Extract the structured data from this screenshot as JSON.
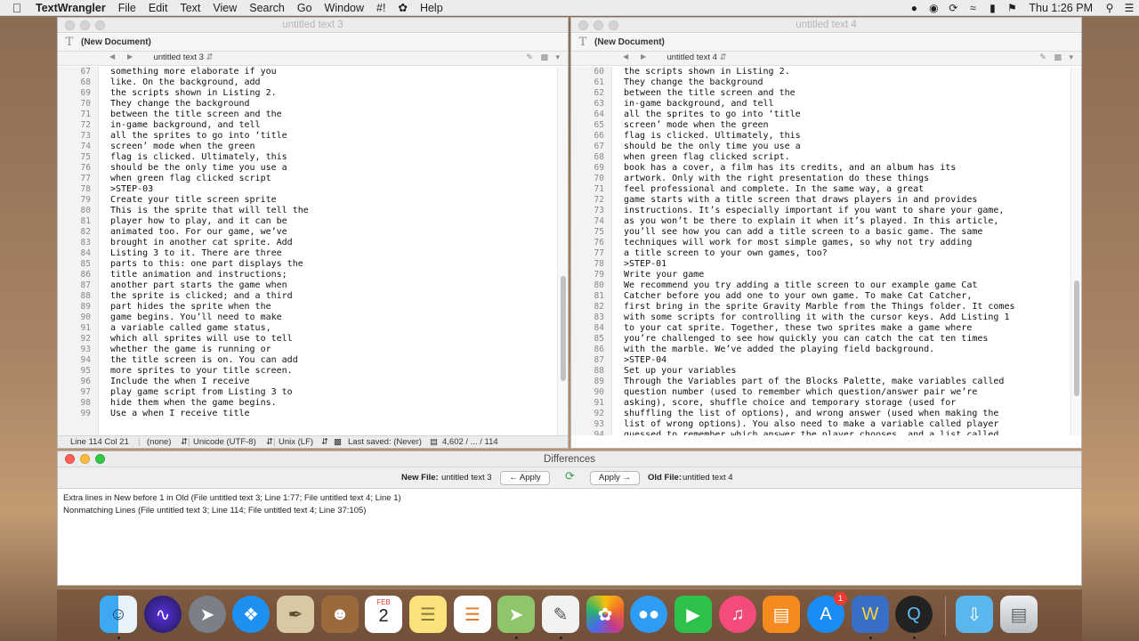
{
  "menubar": {
    "app_name": "TextWrangler",
    "items": [
      "File",
      "Edit",
      "Text",
      "View",
      "Search",
      "Go",
      "Window",
      "#!"
    ],
    "help": "Help",
    "clock": "Thu 1:26 PM"
  },
  "left_window": {
    "title": "untitled text 3",
    "document_label": "(New Document)",
    "tab_name": "untitled text 3",
    "line_numbers": [
      "67",
      "68",
      "69",
      "70",
      "71",
      "72",
      "73",
      "74",
      "75",
      "76",
      "77",
      "78",
      "79",
      "80",
      "81",
      "82",
      "83",
      "84",
      "85",
      "86",
      "87",
      "88",
      "89",
      "90",
      "91",
      "92",
      "93",
      "94",
      "95",
      "96",
      "97",
      "98",
      "99"
    ],
    "lines": [
      "something more elaborate if you",
      "like. On the background, add",
      "the scripts shown in Listing 2.",
      "They change the background",
      "between the title screen and the",
      "in-game background, and tell",
      "all the sprites to go into ‘title",
      "screen’ mode when the green",
      "flag is clicked. Ultimately, this",
      "should be the only time you use a",
      "when green flag clicked script",
      ">STEP-03",
      "Create your title screen sprite",
      "This is the sprite that will tell the",
      "player how to play, and it can be",
      "animated too. For our game, we’ve",
      "brought in another cat sprite. Add",
      "Listing 3 to it. There are three",
      "parts to this: one part displays the",
      "title animation and instructions;",
      "another part starts the game when",
      "the sprite is clicked; and a third",
      "part hides the sprite when the",
      "game begins. You’ll need to make",
      "a variable called game status,",
      "which all sprites will use to tell",
      "whether the game is running or",
      "the title screen is on. You can add",
      "more sprites to your title screen.",
      "Include the when I receive",
      "play game script from Listing 3 to",
      "hide them when the game begins.",
      "Use a when I receive title"
    ],
    "status": {
      "position": "Line 114 Col 21",
      "language": "(none)",
      "encoding": "Unicode (UTF-8)",
      "line_endings": "Unix (LF)",
      "last_saved": "Last saved: (Never)",
      "counts": "4,602 / ... / 114"
    }
  },
  "right_window": {
    "title": "untitled text 4",
    "document_label": "(New Document)",
    "tab_name": "untitled text 4",
    "line_numbers": [
      "60",
      "61",
      "62",
      "63",
      "64",
      "65",
      "66",
      "67",
      "68",
      "69",
      "70",
      "71",
      "72",
      "73",
      "74",
      "75",
      "76",
      "77",
      "78",
      "79",
      "80",
      "81",
      "82",
      "83",
      "84",
      "85",
      "86",
      "87",
      "88",
      "89",
      "90",
      "91",
      "92",
      "93",
      "94"
    ],
    "lines": [
      "the scripts shown in Listing 2.",
      "They change the background",
      "between the title screen and the",
      "in-game background, and tell",
      "all the sprites to go into ‘title",
      "screen’ mode when the green",
      "flag is clicked. Ultimately, this",
      "should be the only time you use a",
      "when green flag clicked script.",
      "book has a cover, a film has its credits, and an album has its",
      "artwork. Only with the right presentation do these things",
      "feel professional and complete. In the same way, a great",
      "game starts with a title screen that draws players in and provides",
      "instructions. It’s especially important if you want to share your game,",
      "as you won’t be there to explain it when it’s played. In this article,",
      "you’ll see how you can add a title screen to a basic game. The same",
      "techniques will work for most simple games, so why not try adding",
      "a title screen to your own games, too?",
      ">STEP-01",
      "Write your game",
      "We recommend you try adding a title screen to our example game Cat",
      "Catcher before you add one to your own game. To make Cat Catcher,",
      "first bring in the sprite Gravity Marble from the Things folder. It comes",
      "with some scripts for controlling it with the cursor keys. Add Listing 1",
      "to your cat sprite. Together, these two sprites make a game where",
      "you’re challenged to see how quickly you can catch the cat ten times",
      "with the marble. We’ve added the playing field background.",
      ">STEP-04",
      "Set up your variables",
      "Through the Variables part of the Blocks Palette, make variables called",
      "question number (used to remember which question/answer pair we’re",
      "asking), score, shuffle choice and temporary storage (used for",
      "shuffling the list of options), and wrong answer (used when making the",
      "list of wrong options). You also need to make a variable called player",
      "guessed to remember which answer the player chooses, and a list called"
    ]
  },
  "differences": {
    "title": "Differences",
    "new_file_label": "New File:",
    "new_file_value": "untitled text 3",
    "apply_left": "← Apply",
    "apply_right": "Apply →",
    "old_file_label": "Old File:",
    "old_file_value": "untitled text 4",
    "entries": [
      "Extra lines in New before 1 in Old (File untitled text 3; Line 1:77; File untitled text 4; Line 1)",
      "Nonmatching Lines (File untitled text 3; Line 114; File untitled text 4; Line 37:105)"
    ]
  },
  "dock": {
    "calendar_month": "FEB",
    "calendar_day": "2",
    "badge_count": "1"
  }
}
